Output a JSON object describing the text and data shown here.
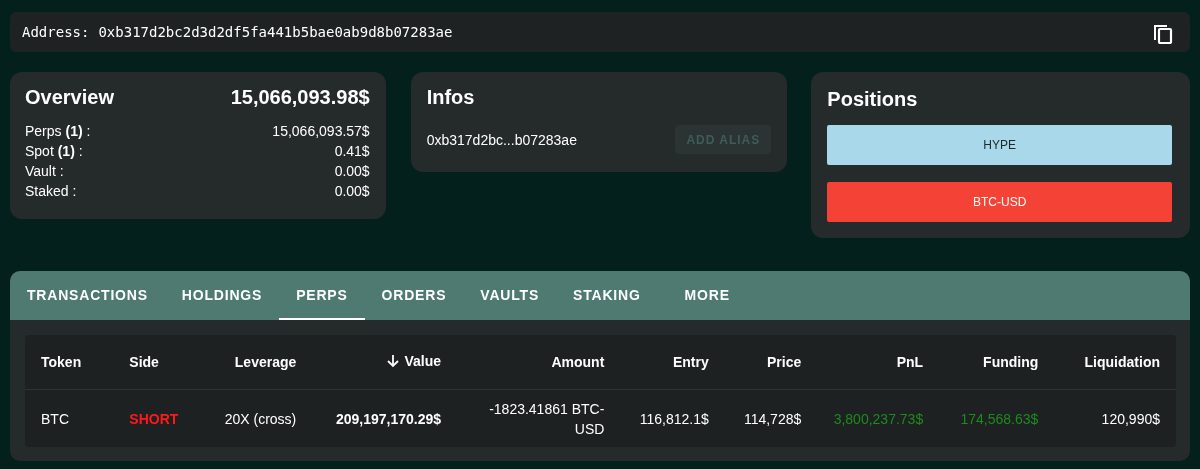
{
  "address_bar": {
    "label": "Address:",
    "value": "0xb317d2bc2d3d2df5fa441b5bae0ab9d8b07283ae"
  },
  "overview": {
    "title": "Overview",
    "total": "15,066,093.98$",
    "rows": [
      {
        "label": "Perps **(1)** :",
        "value": "15,066,093.57$"
      },
      {
        "label": "Spot **(1)** :",
        "value": "0.41$"
      },
      {
        "label": "Vault :",
        "value": "0.00$"
      },
      {
        "label": "Staked :",
        "value": "0.00$"
      }
    ]
  },
  "infos": {
    "title": "Infos",
    "address": "0xb317d2bc...b07283ae",
    "button": {
      "label": "ADD ALIAS",
      "disabled": true
    }
  },
  "positions": {
    "title": "Positions",
    "items": [
      {
        "label": "HYPE",
        "color": "#a8d8ea"
      },
      {
        "label": "BTC-USD",
        "color": "#f44336"
      }
    ]
  },
  "tabs": [
    {
      "label": "TRANSACTIONS",
      "selected": false
    },
    {
      "label": "HOLDINGS",
      "selected": false
    },
    {
      "label": "PERPS",
      "selected": true
    },
    {
      "label": "ORDERS",
      "selected": false
    },
    {
      "label": "VAULTS",
      "selected": false
    },
    {
      "label": "STAKING",
      "selected": false
    },
    {
      "label": "MORE",
      "selected": false
    }
  ],
  "table": {
    "columns": [
      {
        "label": "Token",
        "sorted": false
      },
      {
        "label": "Side",
        "sorted": false
      },
      {
        "label": "Leverage",
        "sorted": false
      },
      {
        "label": "Value",
        "sorted": true
      },
      {
        "label": "Amount",
        "sorted": false
      },
      {
        "label": "Entry",
        "sorted": false
      },
      {
        "label": "Price",
        "sorted": false
      },
      {
        "label": "PnL",
        "sorted": false
      },
      {
        "label": "Funding",
        "sorted": false
      },
      {
        "label": "Liquidation",
        "sorted": false
      }
    ],
    "rows": [
      {
        "cells": [
          {
            "text": "BTC"
          },
          {
            "text": "SHORT",
            "color": "#ff1a1a"
          },
          {
            "text": "20X (cross)"
          },
          {
            "text": "209,197,170.29$"
          },
          {
            "text": "-1823.41861 BTC-USD"
          },
          {
            "text": "116,812.1$"
          },
          {
            "text": "114,728$"
          },
          {
            "text": "3,800,237.73$",
            "color": "#1e8a1e"
          },
          {
            "text": "174,568.63$",
            "color": "#1e8a1e"
          },
          {
            "text": "120,990$"
          }
        ]
      }
    ]
  }
}
